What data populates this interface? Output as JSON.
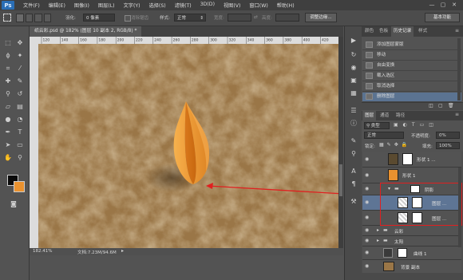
{
  "app": {
    "logo": "Ps"
  },
  "menu": [
    "文件(F)",
    "编辑(E)",
    "图像(I)",
    "图层(L)",
    "文字(Y)",
    "选择(S)",
    "滤镜(T)",
    "3D(D)",
    "视图(V)",
    "窗口(W)",
    "帮助(H)"
  ],
  "window_controls": [
    "—",
    "▢",
    "✕"
  ],
  "options": {
    "feather_label": "羽化:",
    "feather_value": "0 像素",
    "antialias_label": "消除锯齿",
    "style_label": "样式:",
    "style_value": "正常",
    "width_label": "宽度:",
    "height_label": "高度:",
    "refine_edge": "调整边缘...",
    "workspace": "基本功能"
  },
  "document": {
    "tab_title": "纸云彩.psd @ 182% (图层 10 副本 2, RGB/8) *",
    "zoom": "182.41%",
    "doc_info": "文档:7.23M/94.6M",
    "ruler_marks": [
      "120",
      "140",
      "160",
      "180",
      "200",
      "220",
      "240",
      "260",
      "280",
      "300",
      "320",
      "340",
      "360",
      "380",
      "400",
      "420"
    ]
  },
  "history_panel": {
    "tabs": [
      "颜色",
      "色板",
      "历史记录",
      "样式"
    ],
    "active_tab": 2,
    "items": [
      "添加图层蒙版",
      "移动",
      "自由变换",
      "载入选区",
      "取消选择",
      "删除图层"
    ],
    "selected_index": 5
  },
  "layers_panel": {
    "tabs": [
      "图层",
      "通道",
      "路径"
    ],
    "kind_label": "类型",
    "blend_mode": "正常",
    "opacity_label": "不透明度:",
    "opacity_value": "0%",
    "lock_label": "锁定:",
    "fill_label": "填充:",
    "fill_value": "100%",
    "layers": [
      {
        "name": "形状 1 ...",
        "type": "layer"
      },
      {
        "name": "形状 1",
        "type": "layer"
      },
      {
        "name": "阴影",
        "type": "group-open"
      },
      {
        "name": "图层 ...",
        "type": "layer-selected"
      },
      {
        "name": "图层 ...",
        "type": "layer"
      },
      {
        "name": "云彩",
        "type": "group"
      },
      {
        "name": "太阳",
        "type": "group"
      },
      {
        "name": "曲线 1",
        "type": "adjustment"
      },
      {
        "name": "背景 副本",
        "type": "layer"
      }
    ]
  },
  "colors": {
    "accent": "#e9912f",
    "annotation_red": "#e02020",
    "canvas": "#9a7647"
  }
}
